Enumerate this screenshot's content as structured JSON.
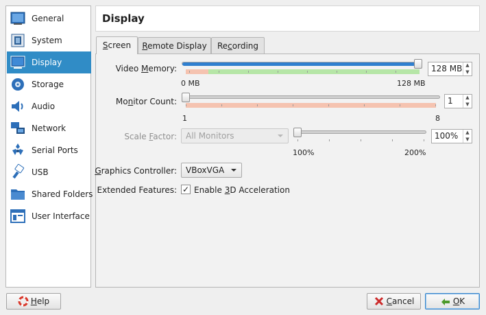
{
  "sidebar": {
    "items": [
      {
        "label": "General",
        "icon": "general-icon"
      },
      {
        "label": "System",
        "icon": "system-icon"
      },
      {
        "label": "Display",
        "icon": "display-icon",
        "selected": true
      },
      {
        "label": "Storage",
        "icon": "storage-icon"
      },
      {
        "label": "Audio",
        "icon": "audio-icon"
      },
      {
        "label": "Network",
        "icon": "network-icon"
      },
      {
        "label": "Serial Ports",
        "icon": "serial-ports-icon"
      },
      {
        "label": "USB",
        "icon": "usb-icon"
      },
      {
        "label": "Shared Folders",
        "icon": "shared-folders-icon"
      },
      {
        "label": "User Interface",
        "icon": "user-interface-icon"
      }
    ]
  },
  "header": {
    "title": "Display"
  },
  "tabs": [
    {
      "label": "Screen",
      "mnemonic": "S",
      "rest": "creen",
      "active": true
    },
    {
      "label": "Remote Display",
      "mnemonic": "R",
      "rest": "emote Display"
    },
    {
      "label": "Recording",
      "pre": "Re",
      "mnemonic": "c",
      "rest": "ording"
    }
  ],
  "screen": {
    "video_memory": {
      "label_pre": "Video ",
      "label_mn": "M",
      "label_post": "emory:",
      "value": "128 MB",
      "min_label": "0 MB",
      "max_label": "128 MB",
      "level": 1.0
    },
    "monitor_count": {
      "label_pre": "Mo",
      "label_mn": "n",
      "label_post": "itor Count:",
      "value": "1",
      "min_label": "1",
      "max_label": "8",
      "level": 0.0
    },
    "scale_factor": {
      "label_pre": "Scale ",
      "label_mn": "F",
      "label_post": "actor:",
      "monitor_select": "All Monitors",
      "value": "100%",
      "min_label": "100%",
      "max_label": "200%",
      "level": 0.0
    },
    "graphics_controller": {
      "label_pre": "",
      "label_mn": "G",
      "label_post": "raphics Controller:",
      "value": "VBoxVGA"
    },
    "extended_features": {
      "label": "Extended Features:",
      "checkbox_pre": "Enable ",
      "checkbox_mn": "3",
      "checkbox_post": "D Acceleration",
      "checked": true,
      "check_glyph": "✓"
    }
  },
  "buttons": {
    "help": {
      "mn": "H",
      "rest": "elp"
    },
    "cancel": {
      "mn": "C",
      "rest": "ancel"
    },
    "ok": {
      "mn": "O",
      "rest": "K"
    }
  },
  "colors": {
    "selection": "#308cc6",
    "slider_fill": "#2f7fcf",
    "band_green": "#b6e6a7",
    "band_red": "#f5c3b0"
  }
}
